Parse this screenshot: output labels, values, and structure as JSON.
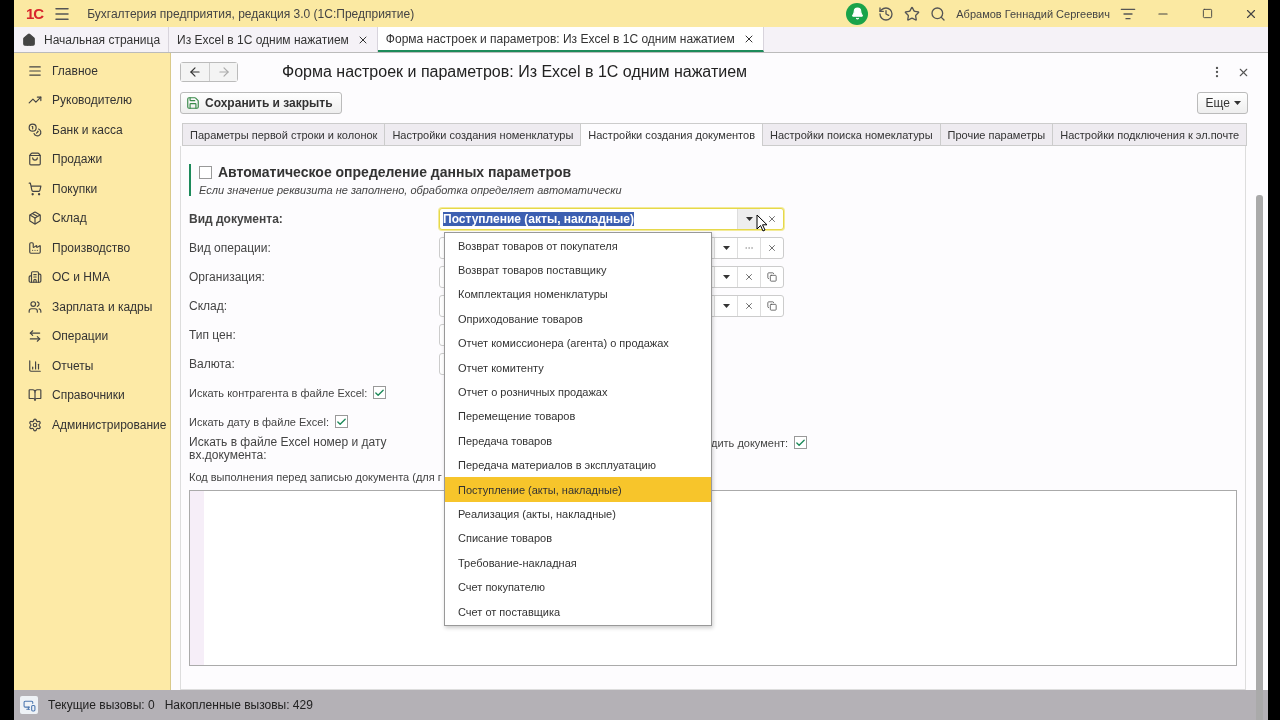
{
  "app_bar": {
    "logo": "1С",
    "title": "Бухгалтерия предприятия, редакция 3.0  (1С:Предприятие)",
    "user": "Абрамов Геннадий Сергеевич"
  },
  "open_tabs": [
    {
      "label": "Начальная страница",
      "kind": "home",
      "selected": false
    },
    {
      "label": "Из Excel в 1С одним нажатием",
      "kind": "page",
      "selected": false
    },
    {
      "label": "Форма настроек и параметров: Из Excel в 1С одним нажатием",
      "kind": "page",
      "selected": true
    }
  ],
  "sidebar": {
    "items": [
      {
        "label": "Главное"
      },
      {
        "label": "Руководителю"
      },
      {
        "label": "Банк и касса"
      },
      {
        "label": "Продажи"
      },
      {
        "label": "Покупки"
      },
      {
        "label": "Склад"
      },
      {
        "label": "Производство"
      },
      {
        "label": "ОС и НМА"
      },
      {
        "label": "Зарплата и кадры"
      },
      {
        "label": "Операции"
      },
      {
        "label": "Отчеты"
      },
      {
        "label": "Справочники"
      },
      {
        "label": "Администрирование"
      }
    ]
  },
  "form": {
    "title": "Форма настроек и параметров: Из Excel в 1С одним нажатием",
    "save_button": "Сохранить и закрыть",
    "more_button": "Еще",
    "tabs": [
      {
        "label": "Параметры первой строки и колонок",
        "selected": false
      },
      {
        "label": "Настройки создания номенклатуры",
        "selected": false
      },
      {
        "label": "Настройки создания документов",
        "selected": true
      },
      {
        "label": "Настройки поиска номеклатуры",
        "selected": false
      },
      {
        "label": "Прочие параметры",
        "selected": false
      },
      {
        "label": "Настройки подключения к эл.почте",
        "selected": false
      }
    ],
    "auto_checkbox": {
      "label": "Автоматическое определение данных параметров",
      "checked": false
    },
    "hint": "Если значение реквизита не заполнено, обработка определяет автоматически",
    "fields": [
      {
        "label": "Вид документа:",
        "kind": "document",
        "value": "Поступление (акты, накладные)"
      },
      {
        "label": "Вид операции:",
        "kind": "choice"
      },
      {
        "label": "Организация:",
        "kind": "ref"
      },
      {
        "label": "Склад:",
        "kind": "ref"
      },
      {
        "label": "Тип цен:",
        "kind": "plain"
      },
      {
        "label": "Валюта:",
        "kind": "plain"
      }
    ],
    "checks": [
      {
        "label": "Искать контрагента в файле Excel:",
        "checked": true
      },
      {
        "label": "Искать дату в файле Excel:",
        "checked": true
      }
    ],
    "number_check": {
      "label": "Искать в файле Excel номер и дату вх.документа:"
    },
    "post_check": {
      "label": "дить документ:",
      "checked": true
    },
    "code_label": "Код выполнения перед записью документа (для г",
    "dropdown": [
      {
        "label": "Возврат товаров от покупателя",
        "selected": false
      },
      {
        "label": "Возврат товаров поставщику",
        "selected": false
      },
      {
        "label": "Комплектация номенклатуры",
        "selected": false
      },
      {
        "label": "Оприходование товаров",
        "selected": false
      },
      {
        "label": "Отчет комиссионера (агента) о продажах",
        "selected": false
      },
      {
        "label": "Отчет комитенту",
        "selected": false
      },
      {
        "label": "Отчет о розничных продажах",
        "selected": false
      },
      {
        "label": "Перемещение товаров",
        "selected": false
      },
      {
        "label": "Передача товаров",
        "selected": false
      },
      {
        "label": "Передача материалов в эксплуатацию",
        "selected": false
      },
      {
        "label": "Поступление (акты, накладные)",
        "selected": true
      },
      {
        "label": "Реализация (акты, накладные)",
        "selected": false
      },
      {
        "label": "Списание товаров",
        "selected": false
      },
      {
        "label": "Требование-накладная",
        "selected": false
      },
      {
        "label": "Счет покупателю",
        "selected": false
      },
      {
        "label": "Счет от поставщика",
        "selected": false
      }
    ]
  },
  "status_bar": {
    "current": "Текущие вызовы: 0",
    "total": "Накопленные вызовы: 429"
  }
}
